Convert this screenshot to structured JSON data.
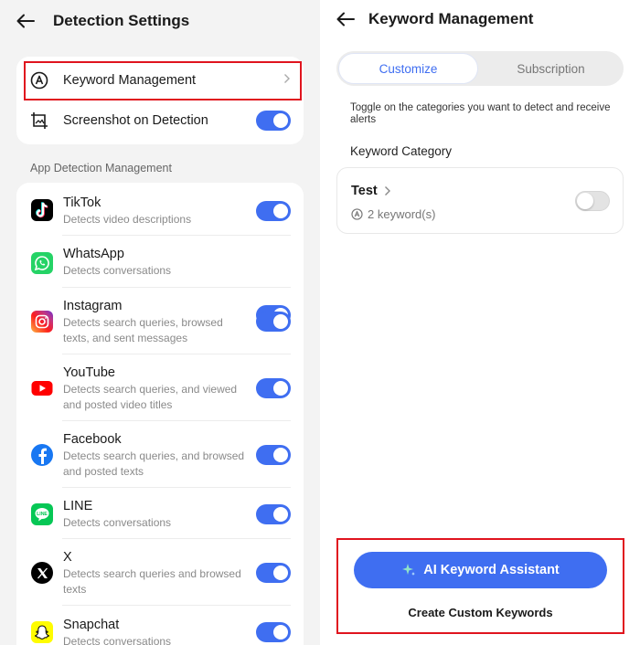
{
  "left": {
    "title": "Detection Settings",
    "settings": [
      {
        "label": "Keyword Management",
        "icon": "keyword-icon"
      },
      {
        "label": "Screenshot on Detection",
        "icon": "screenshot-icon",
        "enabled": true
      }
    ],
    "section_title": "App Detection Management",
    "apps": [
      {
        "name": "TikTok",
        "desc": "Detects video descriptions",
        "enabled": true
      },
      {
        "name": "WhatsApp",
        "desc": "Detects conversations",
        "enabled": true
      },
      {
        "name": "Instagram",
        "desc": "Detects search queries, browsed texts, and sent messages",
        "enabled": true
      },
      {
        "name": "YouTube",
        "desc": "Detects search queries, and viewed and posted video titles",
        "enabled": true
      },
      {
        "name": "Facebook",
        "desc": "Detects search queries, and browsed and posted texts",
        "enabled": true
      },
      {
        "name": "LINE",
        "desc": "Detects conversations",
        "enabled": true
      },
      {
        "name": "X",
        "desc": "Detects search queries and browsed texts",
        "enabled": true
      },
      {
        "name": "Snapchat",
        "desc": "Detects conversations",
        "enabled": true
      }
    ]
  },
  "right": {
    "title": "Keyword Management",
    "tabs": [
      {
        "label": "Customize",
        "active": true
      },
      {
        "label": "Subscription",
        "active": false
      }
    ],
    "hint": "Toggle on the categories you want to detect and receive alerts",
    "category_title": "Keyword Category",
    "categories": [
      {
        "name": "Test",
        "count": "2 keyword(s)",
        "enabled": false
      }
    ],
    "ai_button": "AI Keyword Assistant",
    "create_link": "Create Custom Keywords"
  },
  "colors": {
    "accent": "#3f6ef1",
    "highlight": "#e0141e"
  }
}
